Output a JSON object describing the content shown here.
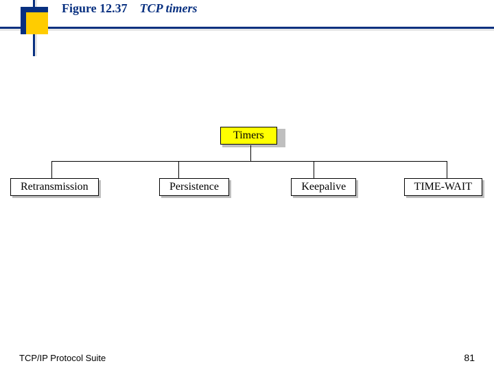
{
  "figure": {
    "number": "Figure 12.37",
    "title": "TCP timers"
  },
  "tree": {
    "root": "Timers",
    "children": [
      "Retransmission",
      "Persistence",
      "Keepalive",
      "TIME-WAIT"
    ]
  },
  "footer": {
    "source": "TCP/IP Protocol Suite",
    "page": "81"
  },
  "colors": {
    "accent_blue": "#083080",
    "accent_yellow": "#ffcc00",
    "root_fill": "#ffff00",
    "shadow": "#bfbfbf"
  }
}
